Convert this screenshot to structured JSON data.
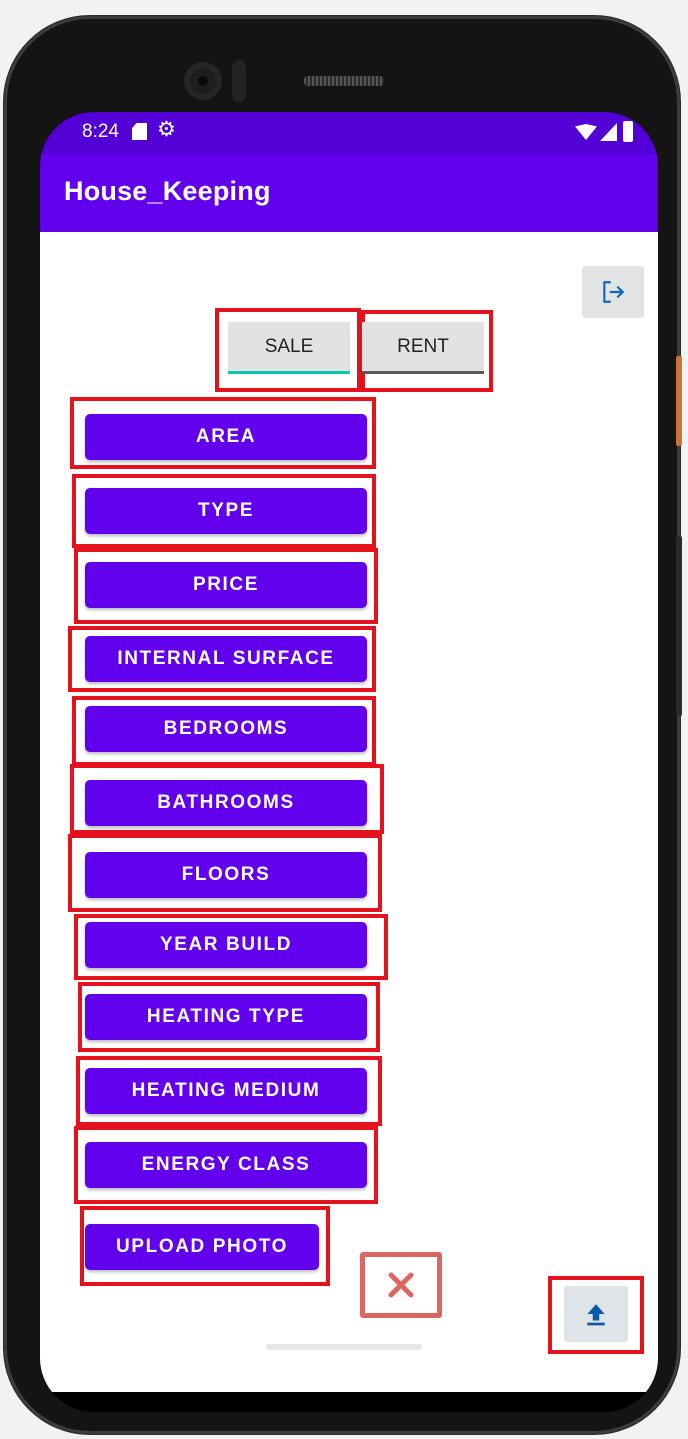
{
  "status_bar": {
    "time": "8:24",
    "icons": [
      "sd-card-icon",
      "settings-gear-icon",
      "wifi-icon",
      "cell-signal-icon",
      "battery-icon"
    ],
    "background": "#5200d6"
  },
  "app_bar": {
    "title": "House_Keeping",
    "background": "#6200ee"
  },
  "top_actions": {
    "logout_icon": "logout-icon"
  },
  "segmented": {
    "sale_label": "SALE",
    "rent_label": "RENT",
    "sale_indicator_color": "#06c7b0"
  },
  "menu_buttons": [
    "AREA",
    "TYPE",
    "PRICE",
    "INTERNAL SURFACE",
    "BEDROOMS",
    "BATHROOMS",
    "FLOORS",
    "YEAR BUILD",
    "HEATING TYPE",
    "HEATING MEDIUM",
    "ENERGY CLASS"
  ],
  "upload_photo_label": "UPLOAD PHOTO",
  "bottom_actions": {
    "delete_icon": "close-x-icon",
    "upload_icon": "upload-icon"
  },
  "colors": {
    "button": "#6200ee",
    "highlight": "#e4121d",
    "delete": "#dc6660"
  }
}
